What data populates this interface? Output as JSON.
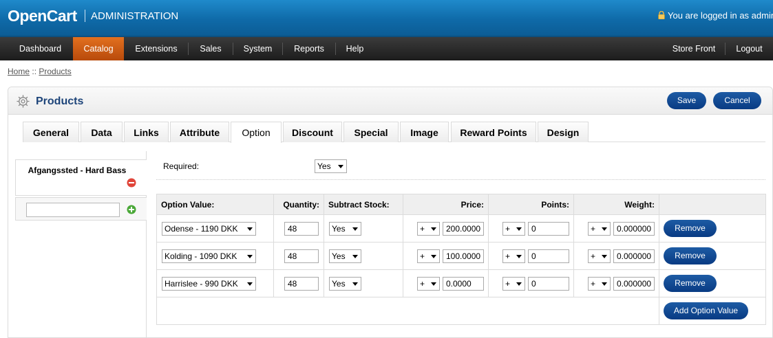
{
  "header": {
    "logo": "OpenCart",
    "subtitle": "ADMINISTRATION",
    "login_text": "You are logged in as admin"
  },
  "menu": {
    "items": [
      "Dashboard",
      "Catalog",
      "Extensions",
      "Sales",
      "System",
      "Reports",
      "Help"
    ],
    "active": "Catalog",
    "right": [
      "Store Front",
      "Logout"
    ]
  },
  "breadcrumb": {
    "home": "Home",
    "separator": "::",
    "current": "Products"
  },
  "page": {
    "title": "Products",
    "save_label": "Save",
    "cancel_label": "Cancel"
  },
  "tabs": [
    "General",
    "Data",
    "Links",
    "Attribute",
    "Option",
    "Discount",
    "Special",
    "Image",
    "Reward Points",
    "Design"
  ],
  "active_tab": "Option",
  "options_list": {
    "items": [
      "Afgangssted - Hard Bass"
    ],
    "add_value": ""
  },
  "option_form": {
    "required_label": "Required:",
    "required_value": "Yes",
    "columns": [
      "Option Value:",
      "Quantity:",
      "Subtract Stock:",
      "Price:",
      "Points:",
      "Weight:"
    ],
    "rows": [
      {
        "option_value": "Odense - 1190 DKK",
        "quantity": "48",
        "subtract": "Yes",
        "price_prefix": "+",
        "price": "200.0000",
        "points_prefix": "+",
        "points": "0",
        "weight_prefix": "+",
        "weight": "0.000000",
        "remove": "Remove"
      },
      {
        "option_value": "Kolding - 1090 DKK",
        "quantity": "48",
        "subtract": "Yes",
        "price_prefix": "+",
        "price": "100.0000",
        "points_prefix": "+",
        "points": "0",
        "weight_prefix": "+",
        "weight": "0.000000",
        "remove": "Remove"
      },
      {
        "option_value": "Harrislee - 990 DKK",
        "quantity": "48",
        "subtract": "Yes",
        "price_prefix": "+",
        "price": "0.0000",
        "points_prefix": "+",
        "points": "0",
        "weight_prefix": "+",
        "weight": "0.000000",
        "remove": "Remove"
      }
    ],
    "add_label": "Add Option Value"
  },
  "colors": {
    "brand_blue": "#0f6aa8",
    "active_menu": "#d2621a",
    "button_blue": "#0b4189",
    "title_blue": "#1d4479"
  },
  "icons": [
    "lock-icon",
    "gear-icon",
    "remove-icon",
    "add-icon",
    "chevron-down-icon"
  ]
}
